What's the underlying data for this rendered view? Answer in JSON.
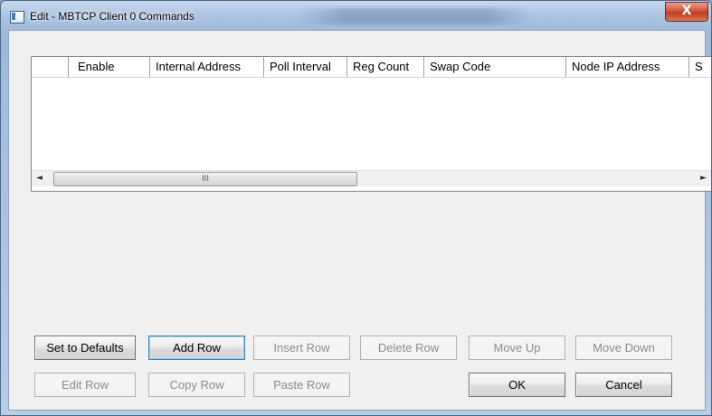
{
  "window": {
    "title": "Edit - MBTCP Client 0 Commands",
    "close_glyph": "X"
  },
  "grid": {
    "columns": [
      "",
      "Enable",
      "Internal Address",
      "Poll Interval",
      "Reg Count",
      "Swap Code",
      "Node IP Address",
      "S"
    ],
    "rows": [],
    "scroll_thumb_glyph": "III",
    "scroll_left_glyph": "◄",
    "scroll_right_glyph": "►"
  },
  "buttons": {
    "set_to_defaults": "Set to Defaults",
    "add_row": "Add Row",
    "insert_row": "Insert Row",
    "delete_row": "Delete Row",
    "move_up": "Move Up",
    "move_down": "Move Down",
    "edit_row": "Edit Row",
    "copy_row": "Copy Row",
    "paste_row": "Paste Row",
    "ok": "OK",
    "cancel": "Cancel"
  },
  "colors": {
    "close_button": "#c8432a",
    "title_bar": "#a9c3e0",
    "dialog_background": "#f0f0f0"
  },
  "icons": {
    "window_icon": "app-window-icon",
    "close": "close-icon"
  }
}
